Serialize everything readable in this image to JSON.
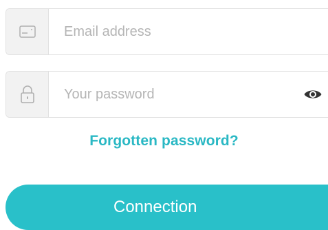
{
  "login": {
    "email": {
      "icon": "id-card-icon",
      "placeholder": "Email address",
      "value": ""
    },
    "password": {
      "icon": "padlock-icon",
      "placeholder": "Your password",
      "value": "",
      "toggle_icon": "eye-icon"
    },
    "forgot_link": "Forgotten password?",
    "submit_label": "Connection"
  },
  "colors": {
    "accent": "#29c0c9",
    "link": "#2ab8c4",
    "field_border": "#e1e1e1",
    "icon_box_bg": "#f2f2f2",
    "placeholder": "#b5b5b5"
  }
}
